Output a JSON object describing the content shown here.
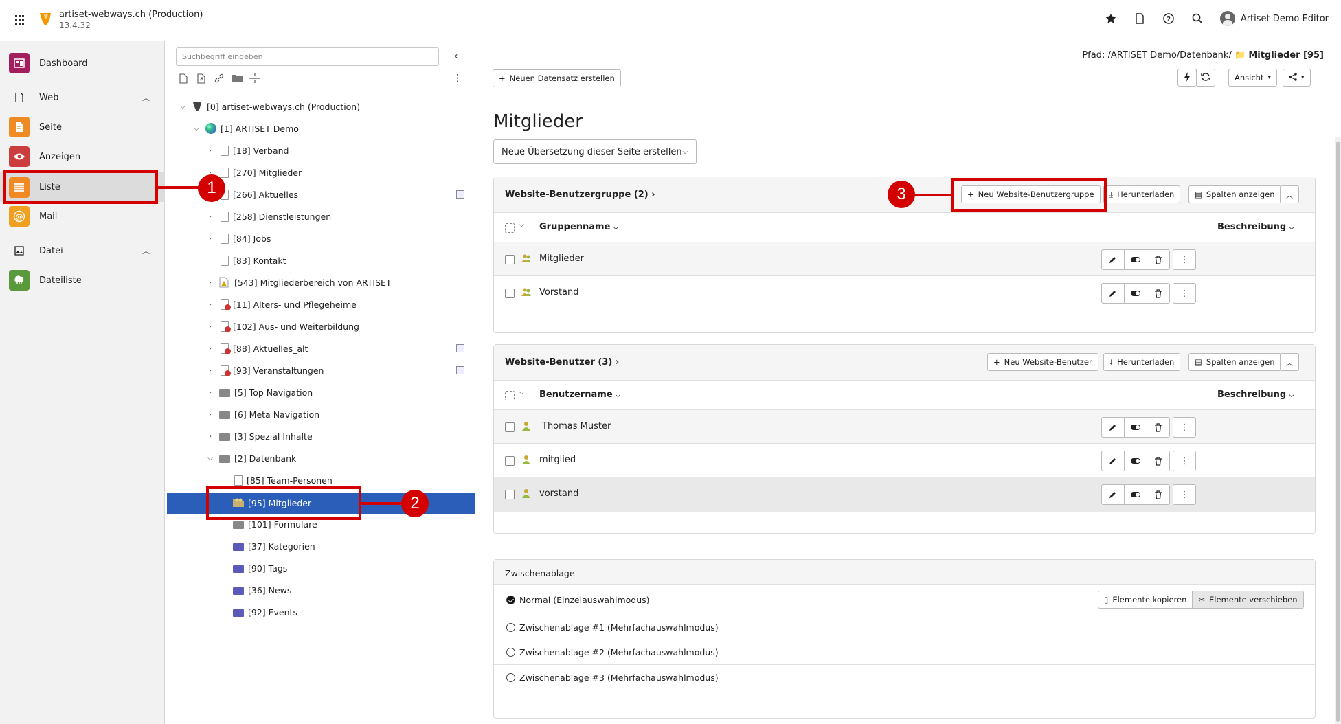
{
  "topbar": {
    "site_title": "artiset-webways.ch (Production)",
    "site_version": "13.4.32",
    "user_name": "Artiset Demo Editor"
  },
  "sidebar": {
    "items": [
      {
        "label": "Dashboard",
        "color": "#a21f5e"
      },
      {
        "label": "Web"
      },
      {
        "label": "Seite",
        "color": "#f08a24"
      },
      {
        "label": "Anzeigen",
        "color": "#cc3d3d"
      },
      {
        "label": "Liste",
        "color": "#f08a24"
      },
      {
        "label": "Mail",
        "color": "#f0a020"
      },
      {
        "label": "Datei"
      },
      {
        "label": "Dateiliste",
        "color": "#5a9a3c"
      }
    ]
  },
  "tree": {
    "search_placeholder": "Suchbegriff eingeben",
    "nodes": [
      "[0] artiset-webways.ch (Production)",
      "[1] ARTISET Demo",
      "[18] Verband",
      "[270] Mitglieder",
      "[266] Aktuelles",
      "[258] Dienstleistungen",
      "[84] Jobs",
      "[83] Kontakt",
      "[543] Mitgliederbereich von ARTISET",
      "[11] Alters- und Pflegeheime",
      "[102] Aus- und Weiterbildung",
      "[88] Aktuelles_alt",
      "[93] Veranstaltungen",
      "[5] Top Navigation",
      "[6] Meta Navigation",
      "[3] Spezial Inhalte",
      "[2] Datenbank",
      "[85] Team-Personen",
      "[95] Mitglieder",
      "[101] Formulare",
      "[37] Kategorien",
      "[90] Tags",
      "[36] News",
      "[92] Events"
    ]
  },
  "main": {
    "path_prefix": "Pfad: /ARTISET Demo/Datenbank/",
    "path_current": "Mitglieder [95]",
    "new_record": "Neuen Datensatz erstellen",
    "view_label": "Ansicht",
    "title": "Mitglieder",
    "translation_select": "Neue Übersetzung dieser Seite erstellen"
  },
  "groups": {
    "title": "Website-Benutzergruppe (2)",
    "new_btn": "Neu Website-Benutzergruppe",
    "download": "Herunterladen",
    "columns": "Spalten anzeigen",
    "col_name": "Gruppenname",
    "col_desc": "Beschreibung",
    "rows": [
      "Mitglieder",
      "Vorstand"
    ]
  },
  "users": {
    "title": "Website-Benutzer (3)",
    "new_btn": "Neu Website-Benutzer",
    "download": "Herunterladen",
    "columns": "Spalten anzeigen",
    "col_name": "Benutzername",
    "col_desc": "Beschreibung",
    "rows": [
      "Thomas Muster",
      "mitglied",
      "vorstand"
    ]
  },
  "clipboard": {
    "title": "Zwischenablage",
    "copy": "Elemente kopieren",
    "move": "Elemente verschieben",
    "options": [
      "Normal (Einzelauswahlmodus)",
      "Zwischenablage #1 (Mehrfachauswahlmodus)",
      "Zwischenablage #2 (Mehrfachauswahlmodus)",
      "Zwischenablage #3 (Mehrfachauswahlmodus)"
    ]
  },
  "annotations": [
    "1",
    "2",
    "3"
  ]
}
